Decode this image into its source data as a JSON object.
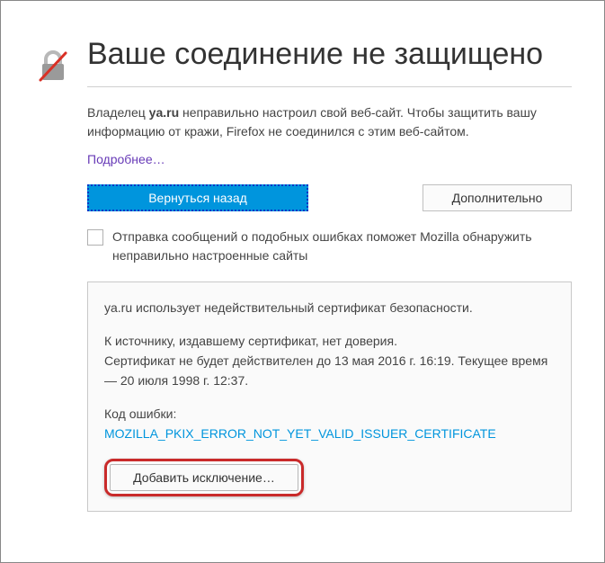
{
  "title": "Ваше соединение не защищено",
  "description_pre": "Владелец ",
  "description_domain": "ya.ru",
  "description_post": " неправильно настроил свой веб-сайт. Чтобы защитить вашу информацию от кражи, Firefox не соединился с этим веб-сайтом.",
  "learn_more": "Подробнее…",
  "go_back": "Вернуться назад",
  "advanced": "Дополнительно",
  "report_text": "Отправка сообщений о подобных ошибках поможет Mozilla обнаружить неправильно настроенные сайты",
  "details": {
    "line1": "ya.ru использует недействительный сертификат безопасности.",
    "line2": "К источнику, издавшему сертификат, нет доверия.\nСертификат не будет действителен до 13 мая 2016 г. 16:19. Текущее время — 20 июля 1998 г. 12:37.",
    "error_label": "Код ошибки: ",
    "error_code": "MOZILLA_PKIX_ERROR_NOT_YET_VALID_ISSUER_CERTIFICATE"
  },
  "add_exception": "Добавить исключение…"
}
